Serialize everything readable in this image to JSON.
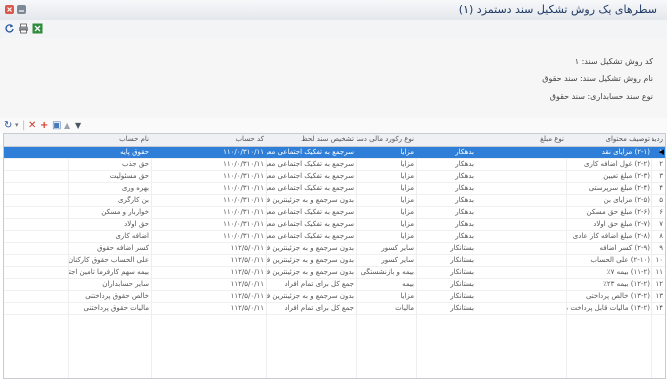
{
  "window": {
    "title": "سطرهای یک روش تشکیل سند دستمزد (۱)"
  },
  "info": {
    "line1": "کد روش تشکیل سند: ۱",
    "line2": "نام روش تشکیل سند: سند حقوق",
    "line3": "نوع سند حسابداری: سند حقوق"
  },
  "grid": {
    "columns": [
      "ردیف",
      "توصیف محتوای",
      "نوع مبلغ",
      "نوع رکورد مالی دستمزد",
      "تشخیص سند لحظ",
      "کد حساب",
      "نام حساب"
    ],
    "rows": [
      [
        "۱",
        "(۲-۱) مزایای نقد",
        "بدهکار",
        "مزایا",
        "سرجمع به تفکیک اجتماعی معینکننده",
        "۱۱۰/۰/۳۱۰/۱۱",
        "حقوق پایه"
      ],
      [
        "۲",
        "(۲-۲) غول اضافه کاری",
        "بدهکار",
        "مزایا",
        "سرجمع به تفکیک اجتماعی معینکننده",
        "۱۱۰/۰/۳۱۰/۱۱",
        "حق جذب"
      ],
      [
        "۳",
        "(۲-۳) مبلغ تعیین",
        "بدهکار",
        "مزایا",
        "سرجمع به تفکیک اجتماعی معینکننده",
        "۱۱۰/۰/۳۱۰/۱۱",
        "حق مسئولیت"
      ],
      [
        "۴",
        "(۲-۴) مبلغ سرپرستی",
        "بدهکار",
        "مزایا",
        "سرجمع به تفکیک اجتماعی معینکننده",
        "۱۱۰/۰/۳۱۰/۱۱",
        "بهره وری"
      ],
      [
        "۵",
        "(۲-۵) مزایای بن",
        "بدهکار",
        "مزایا",
        "بدون سرجمع و به جزئینترین فرم معادل",
        "۱۱۰/۰/۳۱۰/۱۱",
        "بن کارگری"
      ],
      [
        "۶",
        "(۲-۶) مبلغ حق مسکن",
        "بدهکار",
        "مزایا",
        "سرجمع به تفکیک اجتماعی معینکننده",
        "۱۱۰/۰/۳۱۰/۱۱",
        "خواربار و مسکن"
      ],
      [
        "۷",
        "(۲-۷) مبلغ حق اولاد",
        "بدهکار",
        "مزایا",
        "سرجمع به تفکیک اجتماعی معینکننده",
        "۱۱۰/۰/۳۱۰/۱۱",
        "حق اولاد"
      ],
      [
        "۸",
        "(۲-۸) مبلغ اضافه کار عادی",
        "بدهکار",
        "مزایا",
        "سرجمع به تفکیک اجتماعی معینکننده",
        "۱۱۰/۰/۳۱۰/۱۱",
        "اضافه کاری"
      ],
      [
        "۹",
        "(۲-۹) کسر اضافه",
        "بستانکار",
        "سایر کسور",
        "بدون سرجمع و به جزئینترین فرم معادل",
        "۱۱۲/۵/۰/۱۱",
        "کسر اضافه حقوق"
      ],
      [
        "۱۰",
        "(۲-۱۰) علی الحساب",
        "بستانکار",
        "سایر کسور",
        "بدون سرجمع و به جزئینترین فرم معادل",
        "۱۱۲/۵/۰/۱۱",
        "علی الحساب حقوق کارکنان"
      ],
      [
        "۱۱",
        "(۱۱-۲) بیمه ۷٪",
        "بستانکار",
        "بیمه و بازنشستگی",
        "بدون سرجمع و به جزئینترین فرم معادل",
        "۱۱۲/۵/۰/۱۱",
        "بیمه سهم کارفرما تامین اجتماعی"
      ],
      [
        "۱۲",
        "(۱۲-۲) بیمه ۲۳٪",
        "بستانکار",
        "بیمه",
        "جمع کل برای تمام افراد",
        "۱۱۲/۵/۰/۱۱",
        "سایر حسابداران"
      ],
      [
        "۱۳",
        "(۱۳-۲) خالص پرداختی",
        "بستانکار",
        "مزایا",
        "بدون سرجمع و به جزئینترین فرم معادل",
        "۱۱۲/۵/۰/۱۱",
        "خالص حقوق پرداختنی"
      ],
      [
        "۱۴",
        "(۱۴-۲) مالیات قابل پرداخت ماه جاری",
        "بستانکار",
        "مالیات",
        "جمع کل برای تمام افراد",
        "۱۱۲/۵/۰/۱۱",
        "مالیات حقوق پرداختنی"
      ]
    ]
  },
  "colors": {
    "selected_row": "#2f7fd8",
    "title_text": "#1f3a64"
  },
  "icons": [
    "close-icon",
    "minimize-icon",
    "refresh-icon",
    "print-icon",
    "excel-icon",
    "dropdown-icon",
    "delete-icon",
    "add-icon",
    "copy-icon",
    "move-up-icon",
    "move-down-icon"
  ]
}
